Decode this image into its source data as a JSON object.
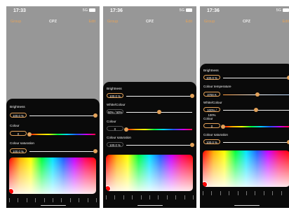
{
  "screens": [
    {
      "time": "17:33",
      "signal_label": "5G",
      "nav": {
        "left": "Group",
        "title": "CPZ",
        "right": "Edit"
      },
      "controls": [
        {
          "label": "Brightness",
          "value": "100.0 %",
          "level": 1.0
        },
        {
          "label": "Colour",
          "value": "0",
          "level": 0.0
        },
        {
          "label": "Colour saturation",
          "value": "100.0 %",
          "level": 1.0
        }
      ]
    },
    {
      "time": "17:36",
      "signal_label": "5G",
      "nav": {
        "left": "Group",
        "title": "CPZ",
        "right": "Edit"
      },
      "controls": [
        {
          "label": "Brightness",
          "value": "100.0 %",
          "level": 1.0
        },
        {
          "label": "White/Colour",
          "value": "50% / 50%",
          "level": 0.5
        },
        {
          "label": "Colour",
          "value": "0",
          "level": 0.0
        },
        {
          "label": "Colour saturation",
          "value": "100.0 %",
          "level": 1.0
        }
      ]
    },
    {
      "time": "17:36",
      "signal_label": "5G",
      "nav": {
        "left": "Group",
        "title": "CPZ",
        "right": "Edit"
      },
      "controls": [
        {
          "label": "Brightness",
          "value": "100.0 %",
          "level": 1.0
        },
        {
          "label": "Colour temperature",
          "value": "3700 K",
          "level": 0.52
        },
        {
          "label": "White/Colour",
          "value": "100% / 100%",
          "level": 0.5
        },
        {
          "label": "Colour",
          "value": "0",
          "level": 0.0
        },
        {
          "label": "Colour saturation",
          "value": "100.0 %",
          "level": 1.0
        }
      ]
    }
  ],
  "colors": {
    "accent": "#e3a25a",
    "panel": "#0a0a0a",
    "screen_bg": "#979797"
  }
}
